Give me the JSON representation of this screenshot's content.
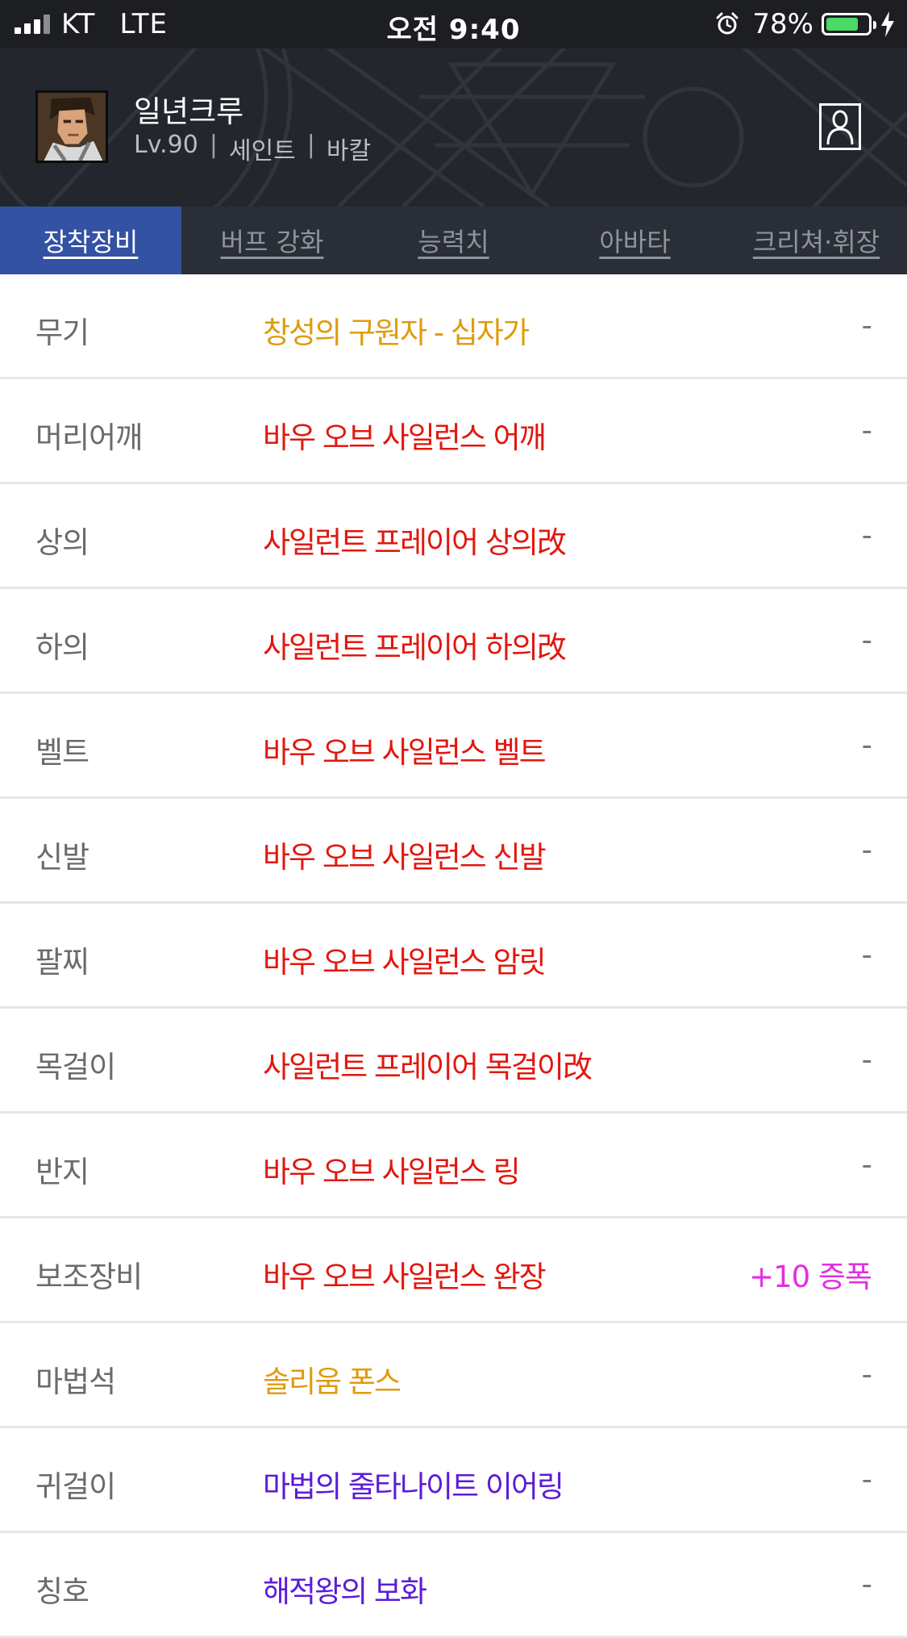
{
  "status_bar": {
    "carrier": "KT",
    "network": "LTE",
    "time": "오전 9:40",
    "battery": "78%",
    "battery_level": 0.78,
    "icons": [
      "signal-icon",
      "alarm-icon",
      "battery-icon",
      "charging-icon"
    ]
  },
  "profile": {
    "name": "일년크루",
    "level": "Lv.90",
    "separator": "|",
    "job": "세인트",
    "server": "바칼",
    "icons": [
      "avatar",
      "profile-icon"
    ]
  },
  "tabs": [
    {
      "label": "장착장비",
      "active": true
    },
    {
      "label": "버프 강화",
      "active": false
    },
    {
      "label": "능력치",
      "active": false
    },
    {
      "label": "아바타",
      "active": false
    },
    {
      "label": "크리쳐·휘장",
      "active": false
    }
  ],
  "colors": {
    "epic": "#e09b0c",
    "legendary": "#e2170f",
    "unique": "#5c1bd8",
    "amplify": "#e42ee0",
    "active_tab": "#3352a3"
  },
  "equipment": [
    {
      "slot": "무기",
      "item": "창성의 구원자 - 십자가",
      "color": "#e09b0c",
      "extra": "-"
    },
    {
      "slot": "머리어깨",
      "item": "바우 오브 사일런스 어깨",
      "color": "#e2170f",
      "extra": "-"
    },
    {
      "slot": "상의",
      "item": "사일런트 프레이어 상의改",
      "color": "#e2170f",
      "extra": "-"
    },
    {
      "slot": "하의",
      "item": "사일런트 프레이어 하의改",
      "color": "#e2170f",
      "extra": "-"
    },
    {
      "slot": "벨트",
      "item": "바우 오브 사일런스 벨트",
      "color": "#e2170f",
      "extra": "-"
    },
    {
      "slot": "신발",
      "item": "바우 오브 사일런스 신발",
      "color": "#e2170f",
      "extra": "-"
    },
    {
      "slot": "팔찌",
      "item": "바우 오브 사일런스 암릿",
      "color": "#e2170f",
      "extra": "-"
    },
    {
      "slot": "목걸이",
      "item": "사일런트 프레이어 목걸이改",
      "color": "#e2170f",
      "extra": "-"
    },
    {
      "slot": "반지",
      "item": "바우 오브 사일런스 링",
      "color": "#e2170f",
      "extra": "-"
    },
    {
      "slot": "보조장비",
      "item": "바우 오브 사일런스 완장",
      "color": "#e2170f",
      "extra": "+10 증폭",
      "extra_color": "#e42ee0"
    },
    {
      "slot": "마법석",
      "item": "솔리움 폰스",
      "color": "#e09b0c",
      "extra": "-"
    },
    {
      "slot": "귀걸이",
      "item": "마법의 줄타나이트 이어링",
      "color": "#5c1bd8",
      "extra": "-"
    },
    {
      "slot": "칭호",
      "item": "해적왕의 보화",
      "color": "#5c1bd8",
      "extra": "-"
    }
  ]
}
